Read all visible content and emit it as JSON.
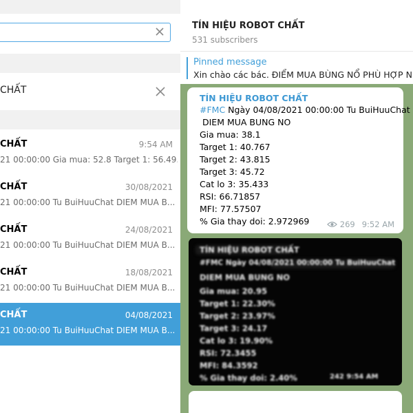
{
  "search": {
    "value": "",
    "placeholder": ""
  },
  "filter": {
    "label": "CHẤT"
  },
  "chats": [
    {
      "name": "CHẤT",
      "date": "9:54 AM",
      "preview": "21 00:00:00  Gia mua: 52.8  Target 1: 56.49..."
    },
    {
      "name": "CHẤT",
      "date": "30/08/2021",
      "preview": "21 00:00:00 Tu BuiHuuChat   DIEM MUA B..."
    },
    {
      "name": "CHẤT",
      "date": "24/08/2021",
      "preview": "21 00:00:00 Tu BuiHuuChat   DIEM MUA B..."
    },
    {
      "name": "CHẤT",
      "date": "18/08/2021",
      "preview": "21 00:00:00 Tu BuiHuuChat   DIEM MUA B..."
    },
    {
      "name": "CHẤT",
      "date": "04/08/2021",
      "preview": "21 00:00:00 Tu BuiHuuChat   DIEM MUA B...",
      "active": true
    }
  ],
  "header": {
    "title": "TÍN HIỆU ROBOT CHẤT",
    "subscribers": "531 subscribers"
  },
  "pinned": {
    "label": "Pinned message",
    "text": "Xin chào các bác.  ĐIỂM MUA BÙNG NỔ PHÙ HỢP NHẤ"
  },
  "message": {
    "channel": "TÍN HIỆU ROBOT CHẤT",
    "hashtag": "#FMC",
    "date_line": " Ngày 04/08/2021 00:00:00 Tu BuiHuuChat",
    "lines": [
      "DIEM MUA BUNG NO",
      "Gia mua: 38.1",
      "Target 1: 40.767",
      "Target 2: 43.815",
      "Target 3: 45.72",
      "Cat lo 3: 35.433",
      "RSI: 66.71857",
      "MFI: 77.57507",
      "% Gia thay doi: 2.972969"
    ],
    "views": "269",
    "time": "9:52 AM"
  },
  "image_message": {
    "lines": [
      "TÍN HIỆU ROBOT CHẤT",
      "#FMC Ngày 04/08/2021 00:00:00 Tu BuiHuuChat",
      "DIEM MUA BUNG NO",
      "Gia mua: 20.95",
      "Target 1: 22.30%",
      "Target 2: 23.97%",
      "Target 3: 24.17",
      "Cat lo 3: 19.90%",
      "RSI: 72.3455",
      "MFI: 84.3592",
      "% Gia thay doi: 2.40%",
      "242  9:54 AM"
    ]
  },
  "colors": {
    "accent": "#419fd9",
    "chat_bg": "#8aa977",
    "bubble": "#ffffff"
  }
}
